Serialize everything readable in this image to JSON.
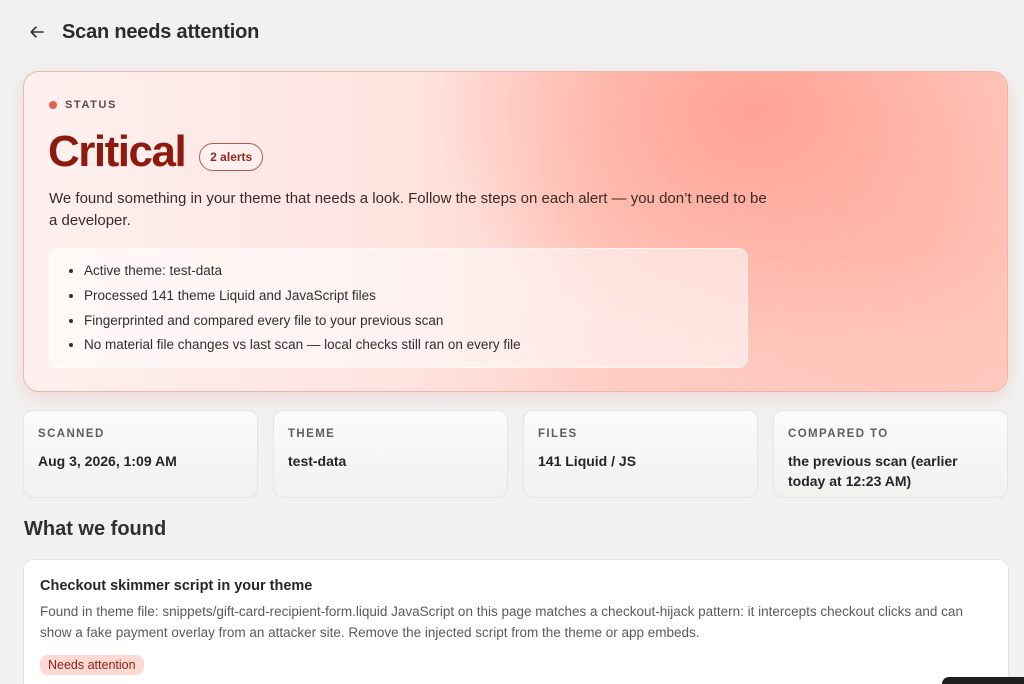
{
  "header": {
    "title": "Scan needs attention",
    "back_icon": "arrow-left-icon"
  },
  "status": {
    "eyebrow": "STATUS",
    "dot_color": "#e8604e",
    "title": "Critical",
    "alerts_badge": "2 alerts",
    "description": "We found something in your theme that needs a look. Follow the steps on each alert — you don’t need to be a developer.",
    "details": [
      "Active theme: test-data",
      "Processed 141 theme Liquid and JavaScript files",
      "Fingerprinted and compared every file to your previous scan",
      "No material file changes vs last scan — local checks still ran on every file"
    ]
  },
  "stats": [
    {
      "label": "SCANNED",
      "value": "Aug 3, 2026, 1:09 AM"
    },
    {
      "label": "THEME",
      "value": "test-data"
    },
    {
      "label": "FILES",
      "value": "141 Liquid / JS"
    },
    {
      "label": "COMPARED TO",
      "value": "the previous scan (earlier today at 12:23 AM)"
    }
  ],
  "findings": {
    "section_title": "What we found",
    "items": [
      {
        "title": "Checkout skimmer script in your theme",
        "description": "Found in theme file: snippets/gift-card-recipient-form.liquid JavaScript on this page matches a checkout-hijack pattern: it intercepts checkout clicks and can show a fake payment overlay from an attacker site. Remove the injected script from the theme or app embeds.",
        "badge": "Needs attention"
      }
    ]
  },
  "colors": {
    "critical_text": "#8e1a0d",
    "badge_bg": "#fcd9d3",
    "page_bg": "#f1f1f1"
  }
}
